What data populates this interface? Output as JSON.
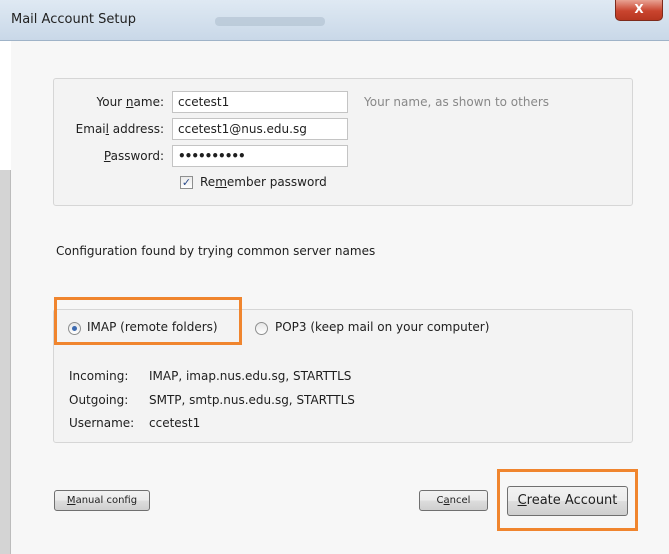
{
  "window": {
    "title": "Mail Account Setup",
    "close_glyph": "X"
  },
  "identity": {
    "name_label": {
      "pre": "Your ",
      "key": "n",
      "post": "ame:"
    },
    "name_value": "ccetest1",
    "name_hint": "Your name, as shown to others",
    "email_label": {
      "pre": "Emai",
      "key": "l",
      "post": " address:"
    },
    "email_value": "ccetest1@nus.edu.sg",
    "password_label": {
      "pre": "",
      "key": "P",
      "post": "assword:"
    },
    "password_value": "••••••••••",
    "remember": {
      "pre": "Re",
      "key": "m",
      "post": "ember password",
      "checked": true
    }
  },
  "status_text": "Configuration found by trying common server names",
  "protocol": {
    "imap_label": "IMAP (remote folders)",
    "pop3_label": "POP3 (keep mail on your computer)",
    "selected": "IMAP"
  },
  "servers": {
    "incoming_label": "Incoming:",
    "incoming_value": "IMAP, imap.nus.edu.sg, STARTTLS",
    "outgoing_label": "Outgoing:",
    "outgoing_value": "SMTP, smtp.nus.edu.sg, STARTTLS",
    "username_label": "Username:",
    "username_value": "ccetest1"
  },
  "buttons": {
    "manual": {
      "key": "M",
      "rest": "anual config"
    },
    "cancel": {
      "pre": "C",
      "key": "a",
      "post": "ncel"
    },
    "create": {
      "key": "C",
      "rest": "reate Account"
    }
  },
  "colors": {
    "highlight": "#f0852e"
  }
}
